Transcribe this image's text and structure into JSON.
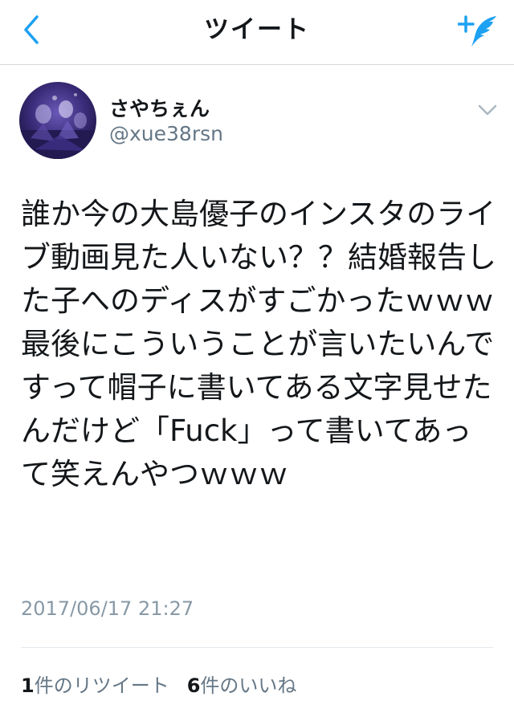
{
  "header": {
    "title": "ツイート",
    "back_icon": "chevron-left-icon",
    "compose_icon": "compose-tweet-icon",
    "accent_color": "#1da1f2"
  },
  "tweet": {
    "display_name": "さやちぇん",
    "username": "@xue38rsn",
    "text": "誰か今の大島優子のインスタのライブ動画見た人いない？？結婚報告した子へのディスがすごかったｗｗｗ最後にこういうことが言いたいんですって帽子に書いてある文字見せたんだけど「Fuck」って書いてあって笑えんやつｗｗｗ",
    "timestamp": "2017/06/17 21:27",
    "retweets": {
      "count": "1",
      "label": "件のリツイート"
    },
    "likes": {
      "count": "6",
      "label": "件のいいね"
    }
  }
}
